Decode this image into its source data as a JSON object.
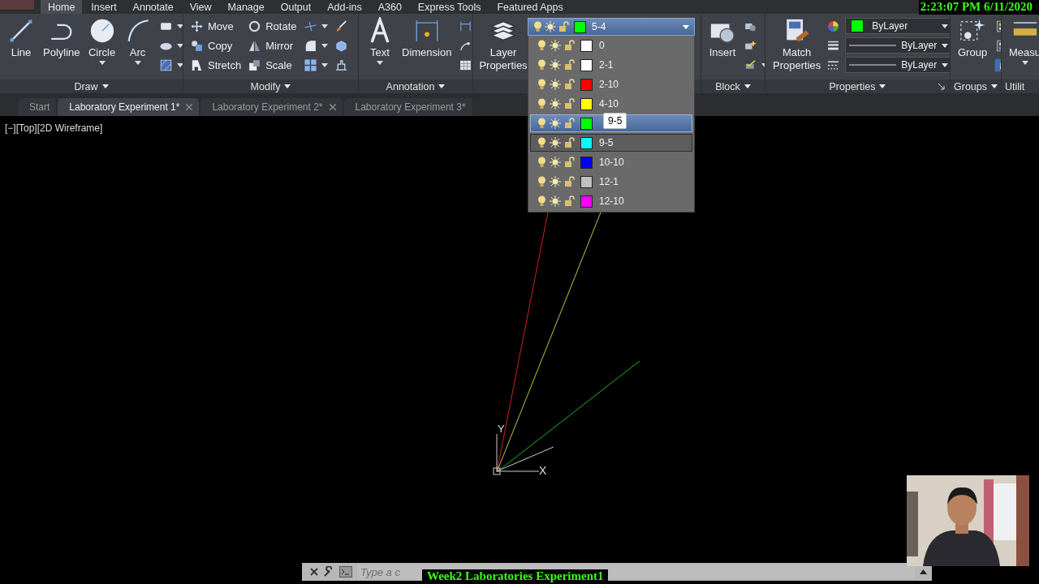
{
  "menu_tabs": [
    {
      "label": "Home",
      "selected": true
    },
    {
      "label": "Insert",
      "selected": false
    },
    {
      "label": "Annotate",
      "selected": false
    },
    {
      "label": "View",
      "selected": false
    },
    {
      "label": "Manage",
      "selected": false
    },
    {
      "label": "Output",
      "selected": false
    },
    {
      "label": "Add-ins",
      "selected": false
    },
    {
      "label": "A360",
      "selected": false
    },
    {
      "label": "Express Tools",
      "selected": false
    },
    {
      "label": "Featured Apps",
      "selected": false
    }
  ],
  "overlay_clock": "2:23:07 PM 6/11/2020",
  "ribbon_panels": [
    {
      "title": "Draw",
      "groups": [
        {
          "kind": "large",
          "label": "Line"
        },
        {
          "kind": "large",
          "label": "Polyline"
        },
        {
          "kind": "large",
          "label": "Circle"
        },
        {
          "kind": "large",
          "label": "Arc"
        },
        {
          "kind": "icon_column"
        }
      ]
    },
    {
      "title": "Modify",
      "groups": [
        {
          "kind": "column",
          "tools": [
            {
              "label": "Move"
            },
            {
              "label": "Copy"
            },
            {
              "label": "Stretch"
            }
          ]
        },
        {
          "kind": "column",
          "tools": [
            {
              "label": "Rotate"
            },
            {
              "label": "Mirror"
            },
            {
              "label": "Scale"
            }
          ]
        },
        {
          "kind": "icon_column"
        },
        {
          "kind": "icon_column"
        }
      ]
    },
    {
      "title": "Annotation",
      "groups": [
        {
          "kind": "large",
          "label": "Text"
        },
        {
          "kind": "large",
          "label": "Dimension"
        },
        {
          "kind": "icon_column"
        }
      ]
    },
    {
      "groups": [
        {
          "kind": "large",
          "label": "Layer Properties"
        }
      ]
    },
    {
      "title": "Block",
      "groups": [
        {
          "kind": "large",
          "label": "Insert"
        },
        {
          "kind": "icon_column"
        }
      ]
    },
    {
      "title": "Properties",
      "groups": [
        {
          "kind": "large",
          "label": "Match Properties"
        },
        {
          "kind": "properties",
          "rows": [
            {
              "kind": "color",
              "label": "ByLayer",
              "color": "#00ff00"
            },
            {
              "kind": "linestyle",
              "label": "ByLayer"
            },
            {
              "kind": "linestyle",
              "label": "ByLayer"
            }
          ]
        }
      ]
    },
    {
      "title": "Groups",
      "groups": [
        {
          "kind": "large",
          "label": "Group"
        },
        {
          "kind": "icon_column"
        }
      ]
    },
    {
      "title": "Utilit",
      "groups": [
        {
          "kind": "large",
          "label": "Measu"
        }
      ]
    }
  ],
  "doc_tabs": [
    {
      "label": "Start",
      "selected": false,
      "closable": false
    },
    {
      "label": "Laboratory Experiment 1*",
      "selected": true,
      "closable": true
    },
    {
      "label": "Laboratory Experiment 2*",
      "selected": false,
      "closable": true
    },
    {
      "label": "Laboratory Experiment 3*",
      "selected": false,
      "closable": false
    }
  ],
  "viewport_label": "[−][Top][2D Wireframe]",
  "layer_dropdown": {
    "current": {
      "name": "5-4",
      "color": "#00ff00"
    },
    "tooltip": "9-5",
    "layers": [
      {
        "name": "0",
        "color": "#ffffff",
        "selected": false,
        "hovered": false
      },
      {
        "name": "2-1",
        "color": "#ffffff",
        "selected": false,
        "hovered": false
      },
      {
        "name": "2-10",
        "color": "#ff0000",
        "selected": false,
        "hovered": false
      },
      {
        "name": "4-10",
        "color": "#ffff00",
        "selected": false,
        "hovered": false
      },
      {
        "color": "#00ff00",
        "selected": true,
        "hovered": false
      },
      {
        "name": "9-5",
        "color": "#00ffff",
        "selected": false,
        "hovered": true
      },
      {
        "name": "10-10",
        "color": "#0000ff",
        "selected": false,
        "hovered": false
      },
      {
        "name": "12-1",
        "color": "#c0c0c0",
        "selected": false,
        "hovered": false
      },
      {
        "name": "12-10",
        "color": "#ff00ff",
        "selected": false,
        "hovered": false
      }
    ]
  },
  "ucs": {
    "y_label": "Y",
    "x_label": "X"
  },
  "command_line": {
    "placeholder": "Type a c"
  },
  "overlay_caption": "Week2 Laboratories Experiment1"
}
